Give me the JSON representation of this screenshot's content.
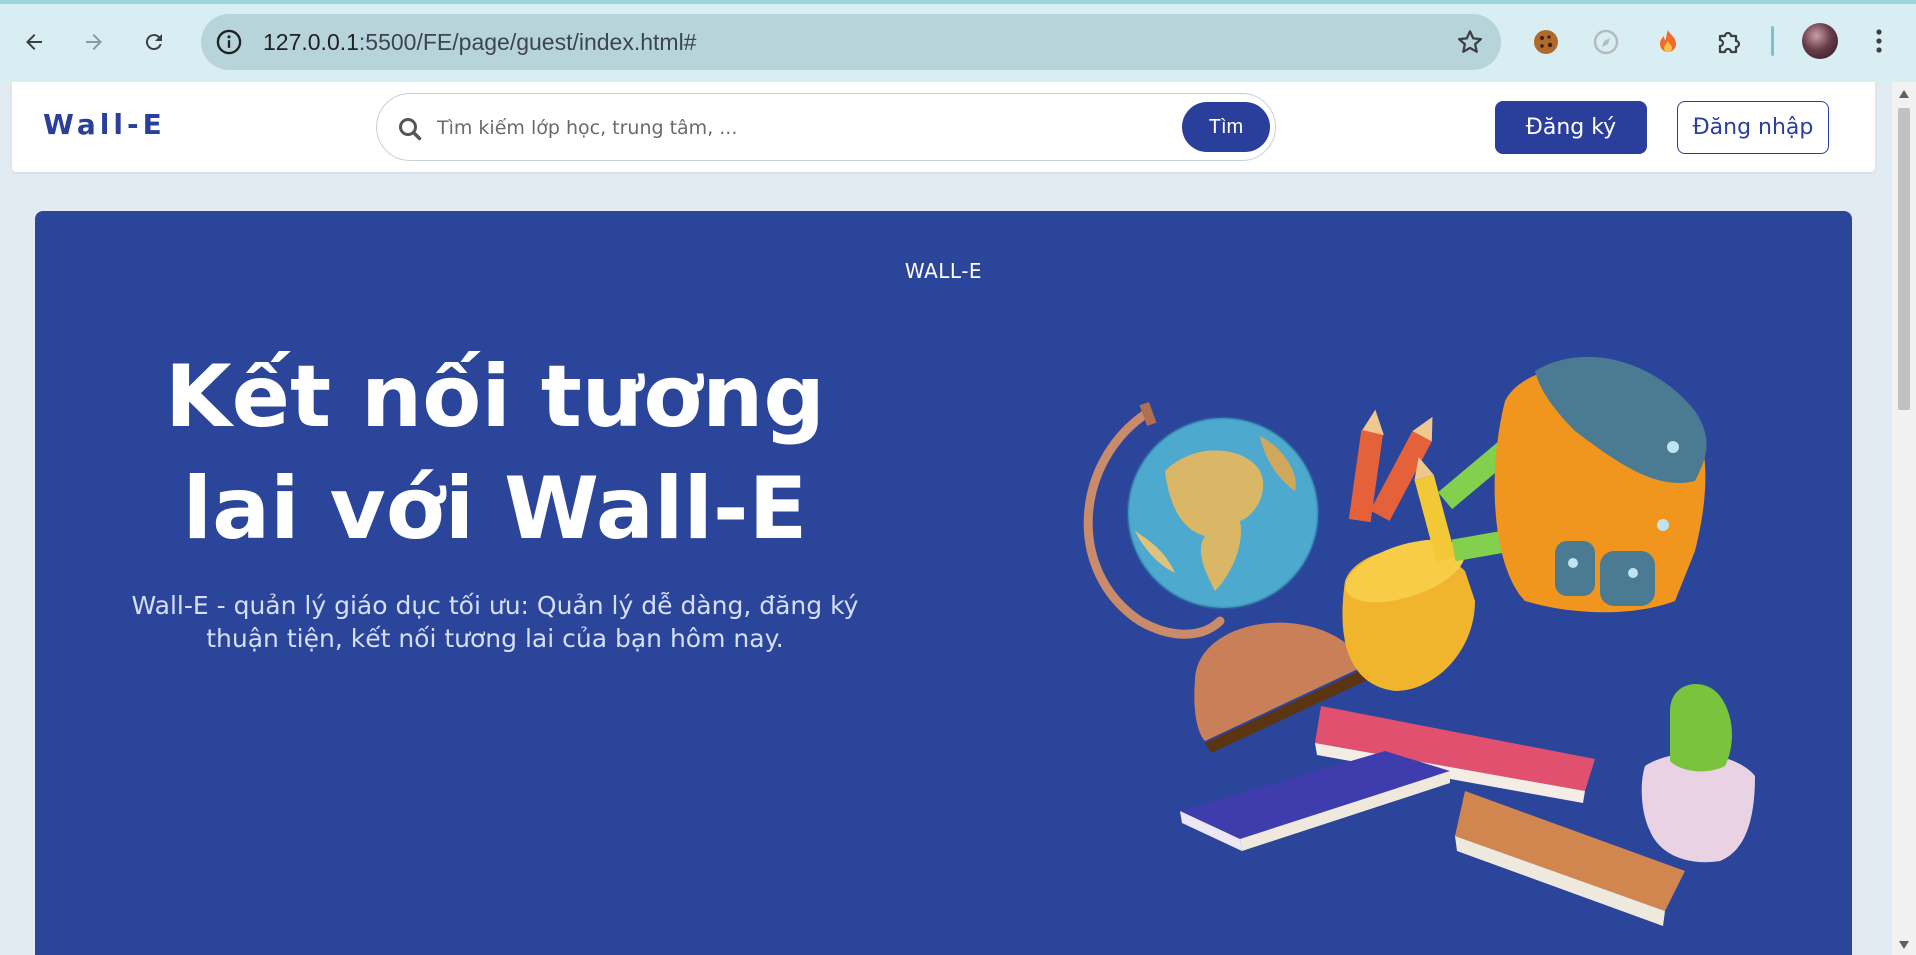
{
  "browser": {
    "url_host": "127.0.0.1",
    "url_path": ":5500/FE/page/guest/index.html#",
    "icons": [
      "back-icon",
      "forward-icon",
      "reload-icon",
      "info-icon",
      "star-icon",
      "cookie-extension-icon",
      "compass-extension-icon",
      "flame-extension-icon",
      "puzzle-extension-icon",
      "profile-avatar",
      "more-menu-icon"
    ]
  },
  "header": {
    "logo": "Wall-E",
    "search": {
      "placeholder": "Tìm kiếm lớp học, trung tâm, ...",
      "button_label": "Tìm"
    },
    "register_label": "Đăng ký",
    "login_label": "Đăng nhập"
  },
  "hero": {
    "eyebrow": "WALL-E",
    "title": "Kết nối tương lai với Wall-E",
    "description": "Wall-E - quản lý giáo dục tối ưu: Quản lý dễ dàng, đăng ký thuận tiện, kết nối tương lai của bạn hôm nay."
  },
  "colors": {
    "brand": "#2a3f9c",
    "hero_bg": "#2a459a",
    "page_bg": "#e2eaf2",
    "chrome_bg": "#d9eef2"
  }
}
